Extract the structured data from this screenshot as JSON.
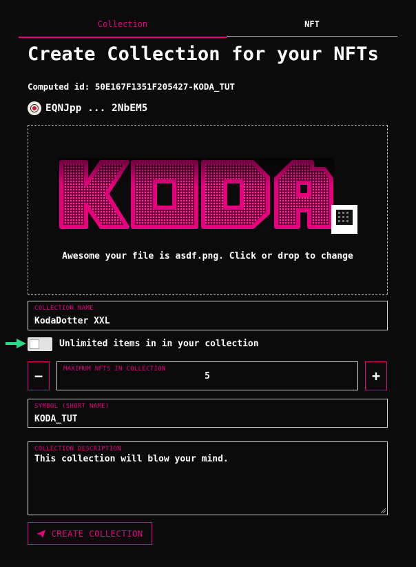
{
  "tabs": [
    {
      "label": "Collection",
      "active": true
    },
    {
      "label": "NFT",
      "active": false
    }
  ],
  "page_title": "Create Collection for your NFTs",
  "computed_id": "Computed id: 50E167F1351F205427-KODA_TUT",
  "account": {
    "address": "EQNJpp ... 2NbEM5",
    "avatar_icon": "account-avatar-icon"
  },
  "upload": {
    "logo_text": "KODA",
    "message_prefix": "Awesome your file is ",
    "file_name": "asdf.png",
    "message_suffix": ". Click or drop to change"
  },
  "collection_name": {
    "label": "COLLECTION NAME",
    "value": "KodaDotter XXL"
  },
  "unlimited_toggle": {
    "label": "Unlimited items in in your collection",
    "checked": false
  },
  "max_nfts": {
    "label": "MAXIMUM NFTS IN COLLECTION",
    "value": "5",
    "decrement": "−",
    "increment": "+"
  },
  "symbol": {
    "label": "SYMBOL (SHORT NAME)",
    "value": "KODA_TUT"
  },
  "description": {
    "label": "COLLECTION DESCRIPTION",
    "value": "This collection will blow your mind."
  },
  "submit": {
    "label": "CREATE COLLECTION",
    "icon": "send-icon"
  },
  "colors": {
    "accent": "#e6007e",
    "background": "#0b0b0b",
    "arrow": "#2bd98b"
  }
}
